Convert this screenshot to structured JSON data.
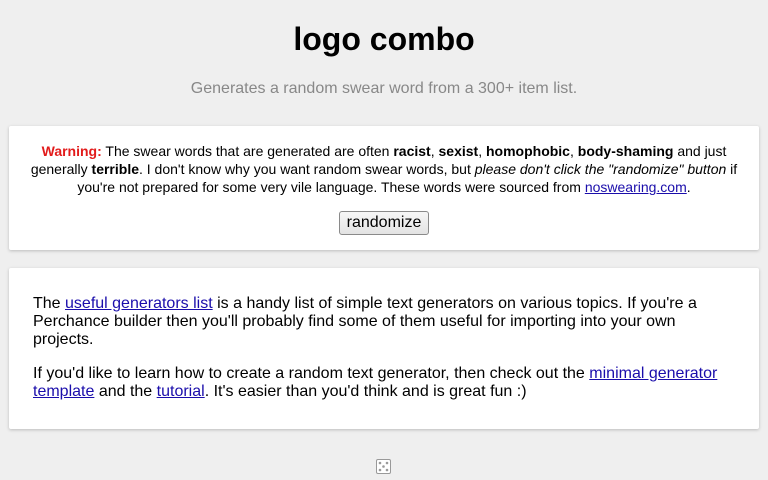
{
  "header": {
    "title": "logo combo",
    "subtitle": "Generates a random swear word from a 300+ item list."
  },
  "warning": {
    "label": "Warning:",
    "t1": " The swear words that are generated are often ",
    "w_racist": "racist",
    "c1": ", ",
    "w_sexist": "sexist",
    "c2": ", ",
    "w_homophobic": "homophobic",
    "c3": ", ",
    "w_body_shaming": "body-shaming",
    "t2": " and just generally ",
    "w_terrible": "terrible",
    "t3": ". I don't know why you want random swear words, but ",
    "italic": "please don't click the \"randomize\" button",
    "t4": " if you're not prepared for some very vile language. These words were sourced from ",
    "source_link": "noswearing.com",
    "t5": "."
  },
  "randomize_button": "randomize",
  "info": {
    "p1_a": "The ",
    "p1_link": "useful generators list",
    "p1_b": " is a handy list of simple text generators on various topics. If you're a Perchance builder then you'll probably find some of them useful for importing into your own projects.",
    "p2_a": "If you'd like to learn how to create a random text generator, then check out the ",
    "p2_link1": "minimal generator template",
    "p2_b": " and the ",
    "p2_link2": "tutorial",
    "p2_c": ". It's easier than you'd think and is great fun :)"
  },
  "footer": {
    "icon": "dice-icon"
  },
  "colors": {
    "background": "#efefef",
    "warning": "#e21b1b",
    "link": "#1a0dab",
    "subtitle": "#888888"
  }
}
